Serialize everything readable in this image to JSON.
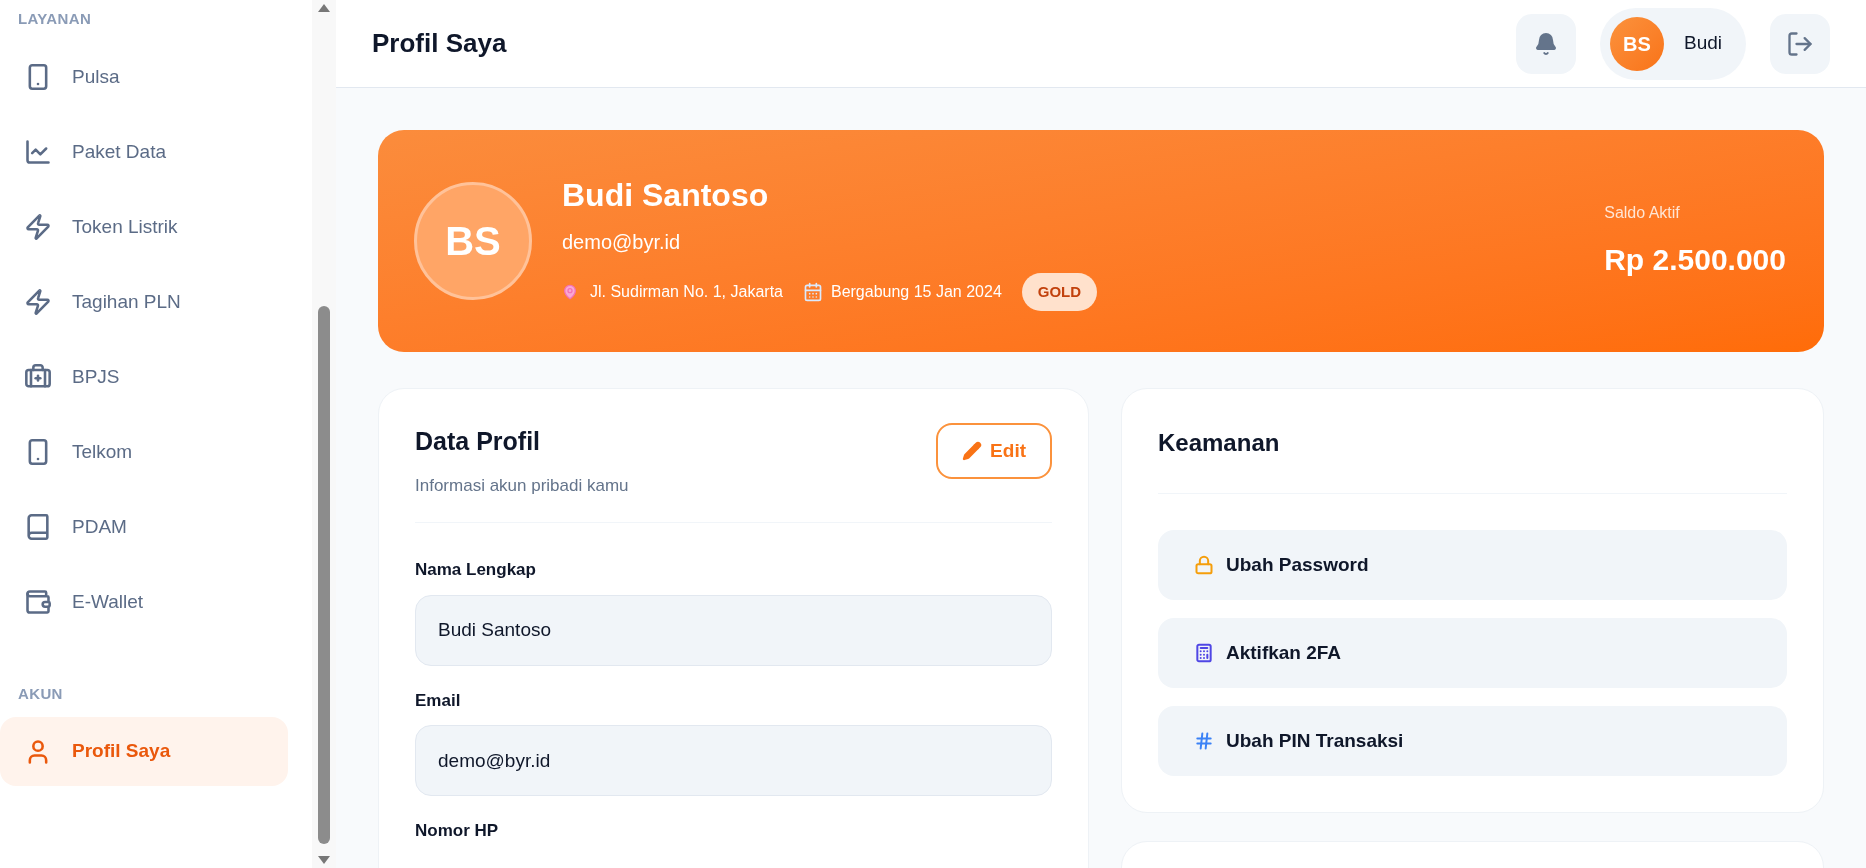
{
  "sidebar": {
    "sections": [
      {
        "title": "LAYANAN",
        "items": [
          {
            "label": "Pulsa",
            "selected": false
          },
          {
            "label": "Paket Data",
            "selected": false
          },
          {
            "label": "Token Listrik",
            "selected": false
          },
          {
            "label": "Tagihan PLN",
            "selected": false
          },
          {
            "label": "BPJS",
            "selected": false
          },
          {
            "label": "Telkom",
            "selected": false
          },
          {
            "label": "PDAM",
            "selected": false
          },
          {
            "label": "E-Wallet",
            "selected": false
          }
        ]
      },
      {
        "title": "AKUN",
        "items": [
          {
            "label": "Profil Saya",
            "selected": true
          }
        ]
      }
    ]
  },
  "header": {
    "title": "Profil Saya",
    "user": {
      "initials": "BS",
      "name": "Budi"
    }
  },
  "banner": {
    "initials": "BS",
    "name": "Budi Santoso",
    "email": "demo@byr.id",
    "address": "Jl. Sudirman No. 1, Jakarta",
    "joined": "Bergabung 15 Jan 2024",
    "tier": "GOLD",
    "balance_label": "Saldo Aktif",
    "balance": "Rp 2.500.000"
  },
  "profile_card": {
    "title": "Data Profil",
    "subtitle": "Informasi akun pribadi kamu",
    "edit_button": "Edit",
    "fields": [
      {
        "label": "Nama Lengkap",
        "value": "Budi Santoso"
      },
      {
        "label": "Email",
        "value": "demo@byr.id"
      },
      {
        "label": "Nomor HP"
      }
    ]
  },
  "security_card": {
    "title": "Keamanan",
    "actions": [
      {
        "label": "Ubah Password"
      },
      {
        "label": "Aktifkan 2FA"
      },
      {
        "label": "Ubah PIN Transaksi"
      }
    ]
  }
}
